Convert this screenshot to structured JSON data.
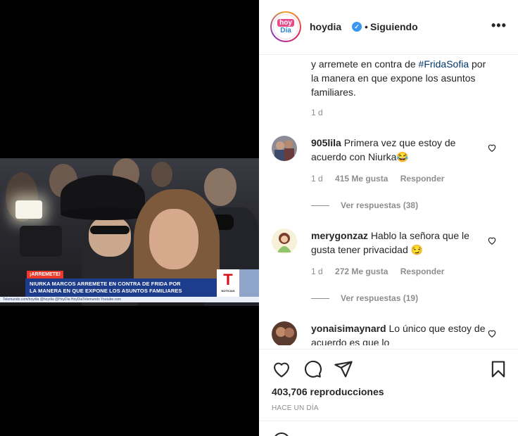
{
  "header": {
    "username": "hoydia",
    "separator": "•",
    "follow_status": "Siguiendo",
    "more_label": "•••",
    "avatar_top": "hoy",
    "avatar_bottom": "Día"
  },
  "video": {
    "tag": "¡ARREMETE!",
    "headline_line1": "NIURKA MARCOS ARREMETE EN CONTRA DE FRIDA POR",
    "headline_line2": "LA MANERA EN QUE EXPONE LOS ASUNTOS FAMILIARES",
    "strip": "Telemundo.com/hoydia   @hoydia   @HoyDia   HoyDiaTelemundo   Youtube.com",
    "network_logo": "T",
    "network_sub": "NOTICIAS"
  },
  "caption": {
    "text_before": "y arremete en contra de ",
    "hashtag": "#FridaSofia",
    "text_after": " por la manera en que expone los asuntos familiares.",
    "time": "1 d"
  },
  "comments": [
    {
      "user": "905lila",
      "text": "Primera vez que estoy de acuerdo con Niurka😂",
      "time": "1 d",
      "likes": "415 Me gusta",
      "reply": "Responder",
      "view_replies": "Ver respuestas (38)"
    },
    {
      "user": "merygonzaz",
      "text": "Hablo la señora que le gusta tener privacidad 😏",
      "time": "1 d",
      "likes": "272 Me gusta",
      "reply": "Responder",
      "view_replies": "Ver respuestas (19)"
    },
    {
      "user": "yonaisimaynard",
      "text": "Lo único que estoy de acuerdo es que lo",
      "time": "",
      "likes": "",
      "reply": "",
      "view_replies": ""
    }
  ],
  "footer": {
    "views": "403,706 reproducciones",
    "date": "HACE UN DÍA"
  },
  "colors": {
    "link": "#00376b",
    "muted": "#8e8e8e",
    "verified": "#3897f0",
    "text": "#262626"
  }
}
